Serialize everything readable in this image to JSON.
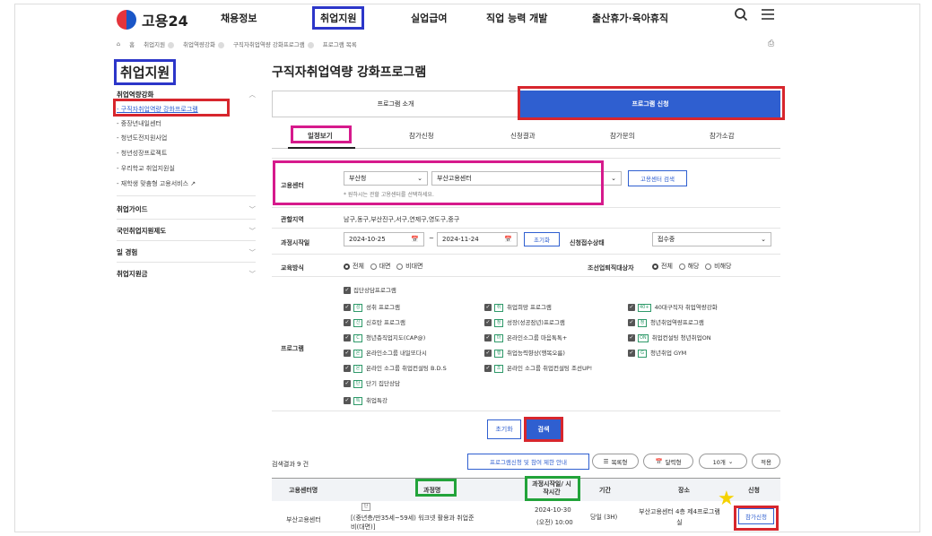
{
  "header": {
    "logo_text": "고용24",
    "nav": [
      "채용정보",
      "취업지원",
      "실업급여",
      "직업 능력 개발",
      "출산휴가·육아휴직"
    ],
    "search_icon": "search-icon",
    "menu_icon": "menu-icon"
  },
  "breadcrumb": [
    "홈",
    "취업지원",
    "취업역량강화",
    "구직자취업역량 강화프로그램",
    "프로그램 목록"
  ],
  "sidebar": {
    "title": "취업지원",
    "group1": "취업역량강화",
    "items": [
      "- 구직자취업역량 강화프로그램",
      "- 중장년내일센터",
      "- 청년도전지원사업",
      "- 청년성장프로젝트",
      "- 우리학교 취업지원실",
      "- 재학생 맞춤형 고용서비스"
    ],
    "groups": [
      "취업가이드",
      "국민취업지원제도",
      "일 경험",
      "취업지원금"
    ]
  },
  "main": {
    "title": "구직자취업역량 강화프로그램",
    "seg_left": "프로그램 소개",
    "seg_right": "프로그램 신청",
    "tabs": [
      "일정보기",
      "참가신청",
      "신청결과",
      "참가문의",
      "참가소감"
    ]
  },
  "form": {
    "center_label": "고용센터",
    "region_select": "부산청",
    "center_select": "부산고용센터",
    "center_search_btn": "고용센터 검색",
    "center_hint": "* 원하시는 관할 고용센터를 선택하세요.",
    "area_label": "관할지역",
    "area_value": "남구,동구,부산진구,서구,연제구,영도구,중구",
    "date_label": "과정시작일",
    "date_from": "2024-10-25",
    "date_sep": "~",
    "date_to": "2024-11-24",
    "reset_small": "초기화",
    "status_label": "신청접수상태",
    "status_value": "접수중",
    "method_label": "교육방식",
    "method_options": [
      "전체",
      "대면",
      "비대면"
    ],
    "ship_label": "조선업퇴직대상자",
    "ship_options": [
      "전체",
      "해당",
      "비해당"
    ],
    "program_label": "프로그램",
    "programs": [
      {
        "tag": "",
        "label": "집단상담프로그램"
      },
      {
        "tag": "성",
        "label": "성취 프로그램"
      },
      {
        "tag": "취",
        "label": "취업희망 프로그램"
      },
      {
        "tag": "40+",
        "label": "40대구직자 취업역량강화"
      },
      {
        "tag": "신",
        "label": "신호탄 프로그램"
      },
      {
        "tag": "청",
        "label": "성장(성공잠년)프로그램"
      },
      {
        "tag": "청",
        "label": "청년취업역량프로그램"
      },
      {
        "tag": "C",
        "label": "청년층직업지도(CAP@)"
      },
      {
        "tag": "마",
        "label": "온라인소그룹 마음톡톡+"
      },
      {
        "tag": "ON",
        "label": "취업컨설팅 청년취업ON"
      },
      {
        "tag": "온",
        "label": "온라인소그룹 내일또다시"
      },
      {
        "tag": "행",
        "label": "취업능력향상(행복오름)"
      },
      {
        "tag": "G",
        "label": "청년취업 GYM"
      },
      {
        "tag": "온",
        "label": "온라인 소그룹 취업컨설팅 B.D.S"
      },
      {
        "tag": "조",
        "label": "온라인 소그룹 취업컨설팅 조선UP!"
      },
      {
        "tag": "단",
        "label": "단기 집단상담"
      },
      {
        "tag": "특",
        "label": "취업특강"
      }
    ],
    "reset_btn": "초기화",
    "search_btn": "검색"
  },
  "results": {
    "count_text": "검색결과 9 건",
    "notice_btn": "프로그램신청 및 참여 제한 안내",
    "list_view": "목록형",
    "calendar_view": "달력형",
    "page_size": "10개",
    "apply_small": "적용",
    "headers": [
      "고용센터명",
      "과정명",
      "과정시작일/ 시작시간",
      "기간",
      "장소",
      "신청"
    ],
    "row": {
      "center": "부산고용센터",
      "tag": "단",
      "course": "[(중년층/만35세~59세) 워크넷 활용과 취업준비(대면)]",
      "date": "2024-10-30",
      "time": "(오전) 10:00",
      "period": "당일 (3H)",
      "place": "부산고용센터 4층 제4프로그램실",
      "apply": "참가신청"
    }
  }
}
